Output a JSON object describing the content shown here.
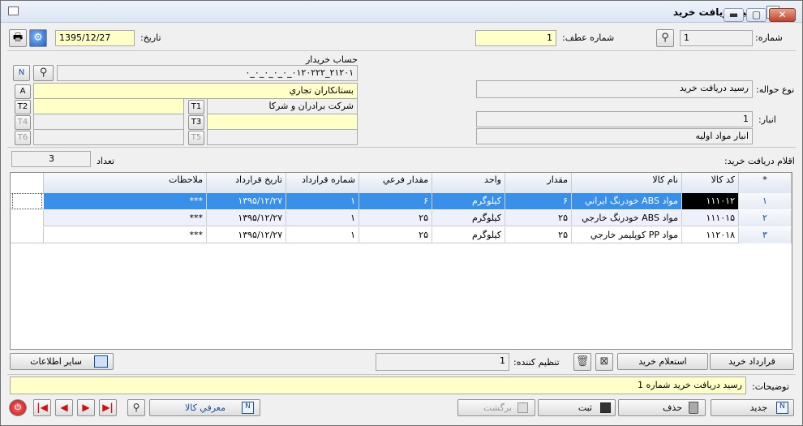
{
  "window": {
    "title": "رسيد دريافت خريد",
    "min": "▬",
    "max": "▢",
    "close": "✕"
  },
  "header": {
    "number_label": "شماره:",
    "number_value": "1",
    "ref_number_label": "شماره عطف:",
    "ref_number_value": "1",
    "date_label": "تاريخ:",
    "date_value": "1395/12/27"
  },
  "buyer": {
    "section_label": "حساب خريدار",
    "account_code": "۲۱۲۰۱_۰۱۲۰۲۲۲_۰_۰_۰_۰_۰",
    "account_name": "بستانكاران تجاري",
    "t1_value": "شركت برادران و شركا",
    "t2_value": "",
    "t3_value": "",
    "t4_value": "",
    "t5_value": "",
    "t6_value": "",
    "a_label": "A",
    "t1_label": "T1",
    "t2_label": "T2",
    "t3_label": "T3",
    "t4_label": "T4",
    "t5_label": "T5",
    "t6_label": "T6"
  },
  "doc": {
    "type_label": "نوع حواله:",
    "type_value": "رسيد دريافت خريد",
    "warehouse_label": "انبار:",
    "warehouse_code": "1",
    "warehouse_name": "انبار مواد اوليه"
  },
  "items_section": {
    "label": "اقلام دريافت خريد:",
    "count_label": "تعداد",
    "count_value": "3"
  },
  "table": {
    "columns": [
      "*",
      "كد كالا",
      "نام كالا",
      "مقدار",
      "واحد",
      "مقدار فرعي",
      "شماره قرارداد",
      "تاريخ قرارداد",
      "ملاحظات"
    ],
    "rows": [
      {
        "num": "۱",
        "code": "۱۱۱۰۱۲",
        "name": "مواد ABS خودرنگ ايراني",
        "qty": "۶",
        "unit": "كيلوگرم",
        "sub_qty": "۶",
        "contract_no": "۱",
        "contract_date": "۱۳۹۵/۱۲/۲۷",
        "notes": "***"
      },
      {
        "num": "۲",
        "code": "۱۱۱۰۱۵",
        "name": "مواد ABS خودرنگ خارجي",
        "qty": "۲۵",
        "unit": "كيلوگرم",
        "sub_qty": "۲۵",
        "contract_no": "۱",
        "contract_date": "۱۳۹۵/۱۲/۲۷",
        "notes": "***"
      },
      {
        "num": "۳",
        "code": "۱۱۲۰۱۸",
        "name": "مواد PP كوپليمر خارجي",
        "qty": "۲۵",
        "unit": "كيلوگرم",
        "sub_qty": "۲۵",
        "contract_no": "۱",
        "contract_date": "۱۳۹۵/۱۲/۲۷",
        "notes": "***"
      }
    ]
  },
  "actions": {
    "contract_button": "قرارداد خريد",
    "inquiry_button": "استعلام خريد",
    "preparer_label": "تنظيم كننده:",
    "preparer_value": "1",
    "other_info_button": "ساير اطلاعات"
  },
  "description": {
    "label": "توضيحات:",
    "value": "رسيد دريافت خريد شماره 1"
  },
  "footer": {
    "new_button": "جديد",
    "delete_button": "حذف",
    "save_button": "ثبت",
    "back_button": "برگشت",
    "product_intro_button": "معرفي كالا"
  },
  "colors": {
    "accent": "#3399ff",
    "field_yellow": "#ffffc8",
    "selected_row": "#3a8fe8"
  }
}
